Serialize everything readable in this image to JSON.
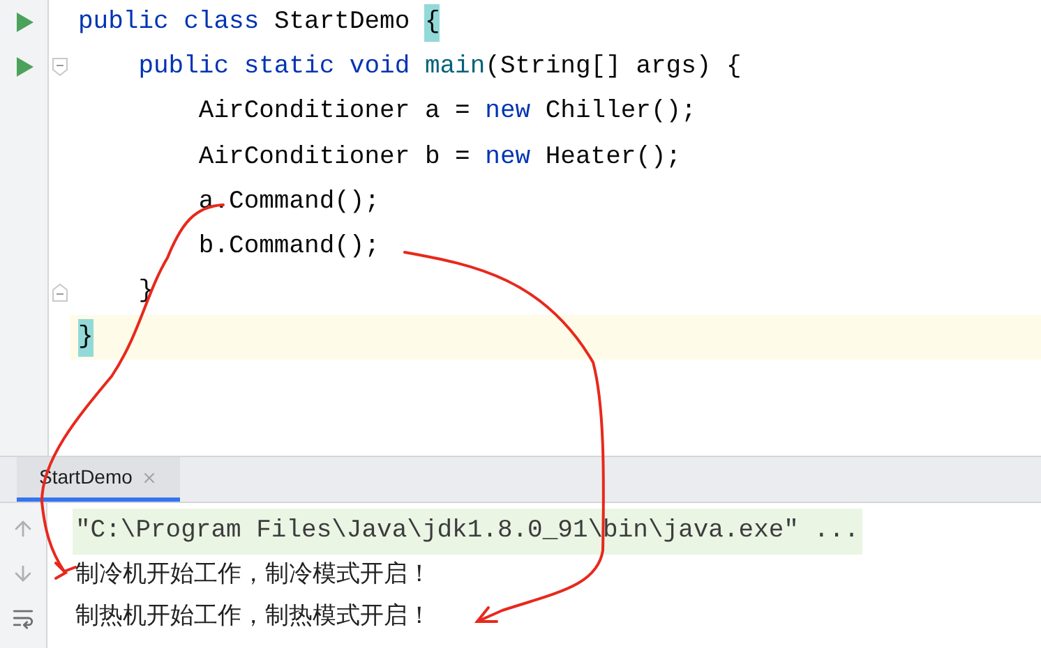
{
  "editor": {
    "lines": [
      {
        "run": true,
        "fold_start": false,
        "fold_end": false,
        "current": false,
        "tokens": [
          {
            "text": "public class ",
            "kind": "keyword"
          },
          {
            "text": "StartDemo ",
            "kind": "plain"
          },
          {
            "text": "{",
            "kind": "brace_match"
          }
        ]
      },
      {
        "run": true,
        "fold_start": true,
        "fold_end": false,
        "current": false,
        "tokens": [
          {
            "text": "    public static void ",
            "kind": "keyword"
          },
          {
            "text": "main",
            "kind": "method"
          },
          {
            "text": "(String[] args) {",
            "kind": "plain"
          }
        ]
      },
      {
        "run": false,
        "fold_start": false,
        "fold_end": false,
        "current": false,
        "tokens": [
          {
            "text": "        AirConditioner a = ",
            "kind": "plain"
          },
          {
            "text": "new ",
            "kind": "keyword"
          },
          {
            "text": "Chiller();",
            "kind": "plain"
          }
        ]
      },
      {
        "run": false,
        "fold_start": false,
        "fold_end": false,
        "current": false,
        "tokens": [
          {
            "text": "        AirConditioner b = ",
            "kind": "plain"
          },
          {
            "text": "new ",
            "kind": "keyword"
          },
          {
            "text": "Heater();",
            "kind": "plain"
          }
        ]
      },
      {
        "run": false,
        "fold_start": false,
        "fold_end": false,
        "current": false,
        "tokens": [
          {
            "text": "        a.Command();",
            "kind": "plain"
          }
        ]
      },
      {
        "run": false,
        "fold_start": false,
        "fold_end": false,
        "current": false,
        "tokens": [
          {
            "text": "        b.Command();",
            "kind": "plain"
          }
        ]
      },
      {
        "run": false,
        "fold_start": false,
        "fold_end": true,
        "current": false,
        "tokens": [
          {
            "text": "    }",
            "kind": "plain"
          }
        ]
      },
      {
        "run": false,
        "fold_start": false,
        "fold_end": false,
        "current": true,
        "tokens": [
          {
            "text": "}",
            "kind": "brace_match"
          }
        ]
      }
    ]
  },
  "run_panel": {
    "tabs": [
      {
        "label": "StartDemo",
        "selected": true
      }
    ],
    "output": [
      {
        "text": "\"C:\\Program Files\\Java\\jdk1.8.0_91\\bin\\java.exe\" ...",
        "kind": "command"
      },
      {
        "text": "制冷机开始工作，制冷模式开启！",
        "kind": "stdout"
      },
      {
        "text": "制热机开始工作，制热模式开启！",
        "kind": "stdout"
      }
    ]
  }
}
